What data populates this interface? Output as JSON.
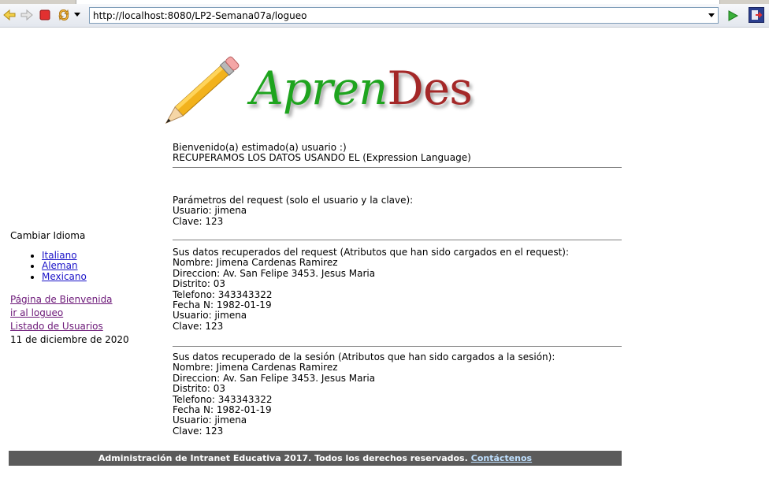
{
  "browser": {
    "url": "http://localhost:8080/LP2-Semana07a/logueo"
  },
  "logo": {
    "part1": "Apren",
    "part2": "Des"
  },
  "welcome": {
    "line1": "Bienvenido(a) estimado(a) usuario :)",
    "line2": "RECUPERAMOS LOS DATOS USANDO EL (Expression Language)"
  },
  "request_params": {
    "heading": "Parámetros del request (solo el usuario y la clave):",
    "usuario": "Usuario: jimena",
    "clave": "Clave: 123"
  },
  "request_data": {
    "heading": "Sus datos recuperados del request (Atributos que han sido cargados en el request):",
    "nombre": "Nombre: Jimena Cardenas Ramirez",
    "direccion": "Direccion: Av. San Felipe 3453. Jesus Maria",
    "distrito": "Distrito: 03",
    "telefono": "Telefono: 343343322",
    "fecha": "Fecha N: 1982-01-19",
    "usuario": "Usuario: jimena",
    "clave": "Clave: 123"
  },
  "session_data": {
    "heading": "Sus datos recuperado de la sesión (Atributos que han sido cargados a la sesión):",
    "nombre": "Nombre: Jimena Cardenas Ramirez",
    "direccion": "Direccion: Av. San Felipe 3453. Jesus Maria",
    "distrito": "Distrito: 03",
    "telefono": "Telefono: 343343322",
    "fecha": "Fecha N: 1982-01-19",
    "usuario": "Usuario: jimena",
    "clave": "Clave: 123"
  },
  "sidebar": {
    "title": "Cambiar Idioma",
    "languages": [
      "Italiano",
      "Aleman",
      "Mexicano"
    ],
    "links": [
      "Página de Bienvenida",
      "ir al logueo",
      "Listado de Usuarios"
    ],
    "date": "11 de diciembre de 2020"
  },
  "footer": {
    "text": "Administración de Intranet Educativa 2017. Todos los derechos reservados.",
    "contact": "Contáctenos"
  },
  "colors": {
    "logo_green": "#1ea41e",
    "logo_red": "#a42828",
    "footer_bg": "#5b5b5b",
    "link": "#1a12c8",
    "visited_link": "#6c1878"
  }
}
